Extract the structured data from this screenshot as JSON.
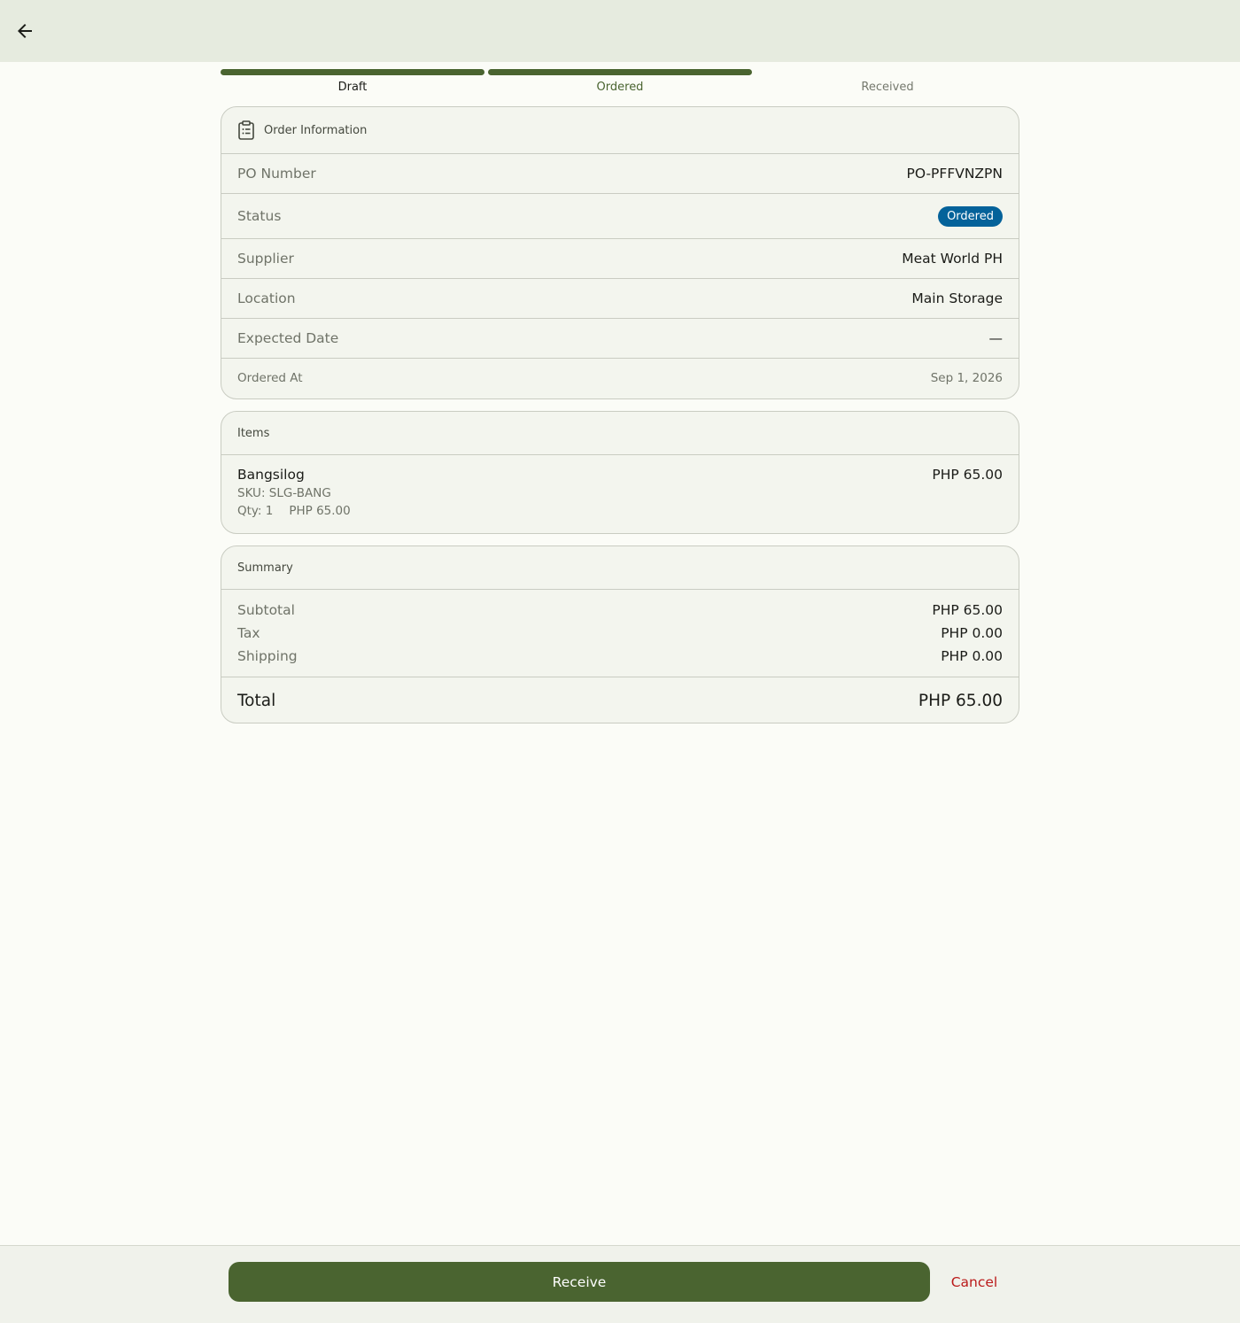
{
  "header": {
    "back_icon": "arrow-left-icon"
  },
  "stepper": {
    "steps": [
      {
        "label": "Draft",
        "state": "done"
      },
      {
        "label": "Ordered",
        "state": "current"
      },
      {
        "label": "Received",
        "state": "pending"
      }
    ],
    "colors": {
      "active": "#4a6430",
      "inactive_text": "#75796e",
      "done_text": "#1b1c18"
    }
  },
  "order_info": {
    "title": "Order Information",
    "icon": "clipboard-icon",
    "rows": {
      "po_number": {
        "label": "PO Number",
        "value": "PO-PFFVNZPN"
      },
      "status": {
        "label": "Status",
        "value": "Ordered",
        "color": "#04629a"
      },
      "supplier": {
        "label": "Supplier",
        "value": "Meat World PH"
      },
      "location": {
        "label": "Location",
        "value": "Main Storage"
      },
      "expected_date": {
        "label": "Expected Date",
        "value": "—"
      },
      "ordered_at": {
        "label": "Ordered At",
        "value": "Sep 1, 2026"
      }
    }
  },
  "items": {
    "title": "Items",
    "list": [
      {
        "name": "Bangsilog",
        "sku": "SKU: SLG-BANG",
        "qty": "Qty: 1",
        "unit_price": "PHP 65.00",
        "line_total": "PHP 65.00"
      }
    ]
  },
  "summary": {
    "title": "Summary",
    "subtotal": {
      "label": "Subtotal",
      "value": "PHP 65.00"
    },
    "tax": {
      "label": "Tax",
      "value": "PHP 0.00"
    },
    "shipping": {
      "label": "Shipping",
      "value": "PHP 0.00"
    },
    "total": {
      "label": "Total",
      "value": "PHP 65.00"
    }
  },
  "actions": {
    "receive_label": "Receive",
    "cancel_label": "Cancel",
    "primary_color": "#4a6430",
    "danger_color": "#ba1a1a"
  }
}
